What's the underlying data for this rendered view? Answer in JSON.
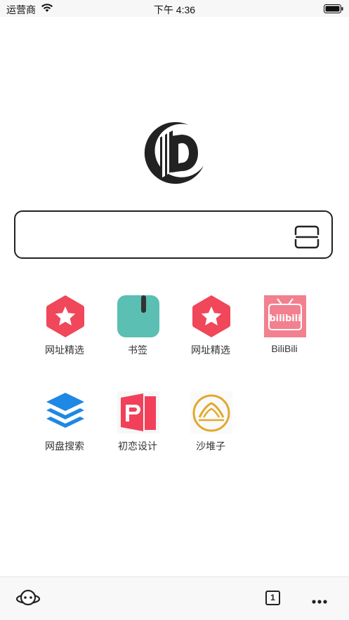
{
  "status_bar": {
    "carrier": "运营商",
    "time": "下午 4:36"
  },
  "search": {
    "placeholder": ""
  },
  "shortcuts": [
    {
      "label": "网址精选",
      "icon": "star-hexagon-icon",
      "color": "#f0475a"
    },
    {
      "label": "书签",
      "icon": "bookmark-icon",
      "color": "#5bbfb3"
    },
    {
      "label": "网址精选",
      "icon": "star-hexagon-icon",
      "color": "#f0475a"
    },
    {
      "label": "BiliBili",
      "icon": "bilibili-icon",
      "color": "#f2808f"
    },
    {
      "label": "网盘搜索",
      "icon": "layers-icon",
      "color": "#1e88e5"
    },
    {
      "label": "初恋设计",
      "icon": "p-logo-icon",
      "color": "#f2405a"
    },
    {
      "label": "沙堆子",
      "icon": "sand-logo-icon",
      "color": "#e3a82b"
    }
  ],
  "bottom_bar": {
    "tab_count": "1"
  },
  "colors": {
    "accent": "#f0475a",
    "text": "#333333"
  }
}
